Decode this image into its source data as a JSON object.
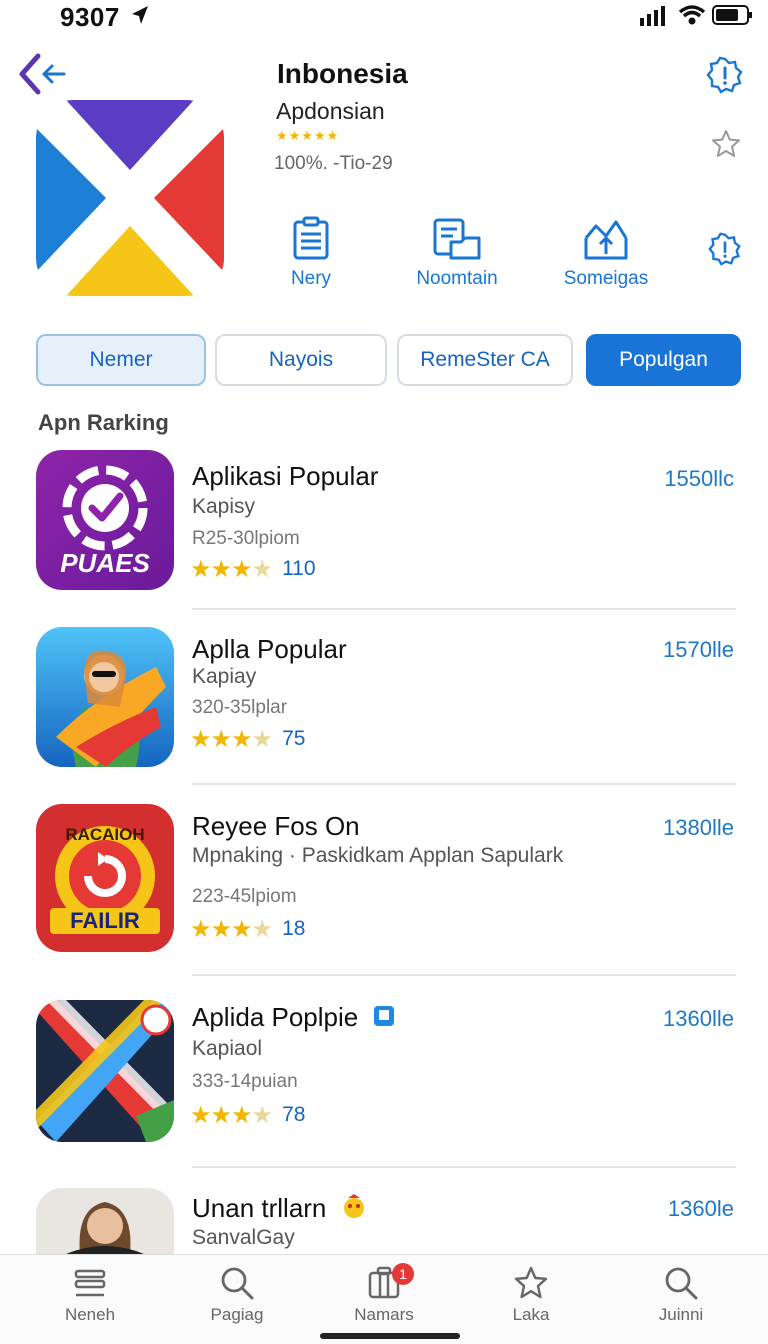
{
  "status": {
    "time": "9307"
  },
  "header": {
    "title": "Inbonesia",
    "subtitle": "Apdonsian",
    "stars": "★★★★★",
    "meta": "100%. -Tio-29"
  },
  "actions": [
    {
      "label": "Nery",
      "icon": "document-list-icon"
    },
    {
      "label": "Noomtain",
      "icon": "clipboard-folder-icon"
    },
    {
      "label": "Someigas",
      "icon": "upload-tray-icon"
    }
  ],
  "segments": [
    "Nemer",
    "Nayois",
    "RemeSter CA",
    "Populgan"
  ],
  "section_title": "Apn Rarking",
  "apps": [
    {
      "name": "Aplikasi Popular",
      "sub": "Kapisy",
      "size": "R25-30lpiom",
      "count": "110",
      "price": "1550llc",
      "icon_text": "PUAES",
      "rating": 3.5
    },
    {
      "name": "Aplla Popular",
      "sub": "Kapiay",
      "size": "320-35lplar",
      "count": "75",
      "price": "1570lle",
      "rating": 3.5
    },
    {
      "name": "Reyee Fos On",
      "sub": "Mpnaking · Paskidkam Applan Sapulark",
      "size": "223-45lpiom",
      "count": "18",
      "price": "1380lle",
      "icon_top": "RACAIOH",
      "icon_text": "FAILIR",
      "rating": 3.5
    },
    {
      "name": "Aplida Poplpie",
      "sub": "Kapiaol",
      "size": "333-14puian",
      "count": "78",
      "price": "1360lle",
      "rating": 3.5
    },
    {
      "name": "Unan trllarn",
      "sub": "SanvalGay",
      "size": "",
      "count": "",
      "price": "1360le",
      "rating": 0
    }
  ],
  "tabs": [
    {
      "label": "Neneh",
      "icon": "stack-icon"
    },
    {
      "label": "Pagiag",
      "icon": "search-icon"
    },
    {
      "label": "Namars",
      "icon": "apps-icon",
      "badge": "1"
    },
    {
      "label": "Laka",
      "icon": "star-icon"
    },
    {
      "label": "Juinni",
      "icon": "search-icon"
    }
  ],
  "colors": {
    "accent": "#1a73d6",
    "star": "#f2b600",
    "badge": "#e53935"
  }
}
